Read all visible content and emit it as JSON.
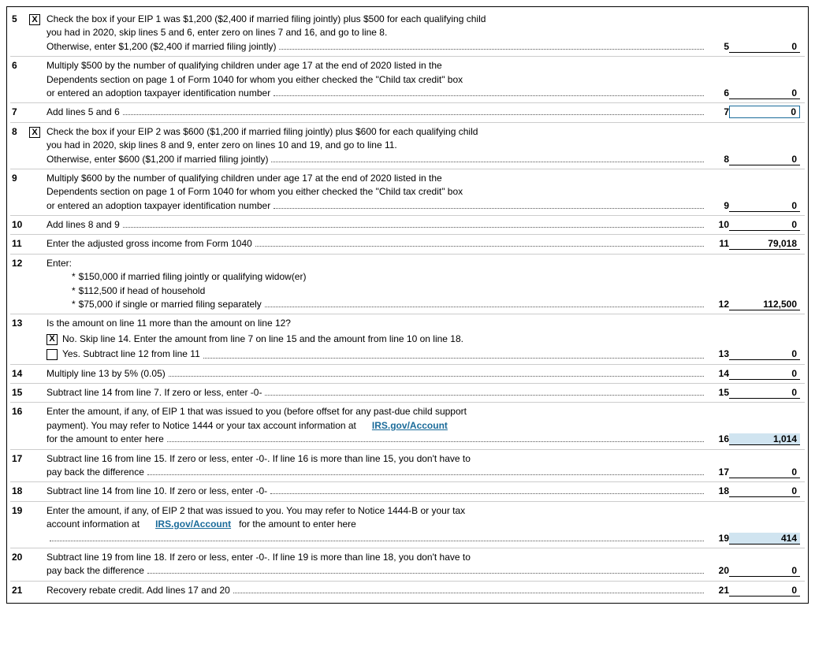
{
  "form": {
    "rows": [
      {
        "id": "row5",
        "lineNum": "5",
        "hasCheckbox": true,
        "checkboxChecked": true,
        "checkboxLabel": "X",
        "content": [
          "Check the box if your EIP 1 was $1,200 ($2,400 if married filing jointly) plus $500 for each qualifying child",
          "you had in 2020, skip lines 5 and 6, enter zero on lines 7 and 16, and go to line 8.",
          "Otherwise, enter $1,200 ($2,400 if married filing jointly)"
        ],
        "dotsLabel": "5",
        "value": "0",
        "valueStyle": "normal"
      },
      {
        "id": "row6",
        "lineNum": "6",
        "hasCheckbox": false,
        "content": [
          "Multiply $500 by the number of qualifying children under age 17 at the end of 2020 listed in the",
          "Dependents section on page 1 of Form 1040 for whom you either checked the \"Child tax credit\" box",
          "or entered an adoption taxpayer identification number"
        ],
        "dotsLabel": "6",
        "value": "0",
        "valueStyle": "normal"
      },
      {
        "id": "row7",
        "lineNum": "7",
        "hasCheckbox": false,
        "content": [
          "Add lines 5 and 6"
        ],
        "dotsLabel": "7",
        "value": "0",
        "valueStyle": "boxed"
      },
      {
        "id": "row8",
        "lineNum": "8",
        "hasCheckbox": true,
        "checkboxChecked": true,
        "checkboxLabel": "X",
        "content": [
          "Check the box if your EIP 2 was $600 ($1,200 if married filing jointly) plus $600 for each qualifying child",
          "you had in 2020, skip lines 8 and 9, enter zero on lines 10 and 19, and go to line 11.",
          "Otherwise, enter $600 ($1,200 if married filing jointly)"
        ],
        "dotsLabel": "8",
        "value": "0",
        "valueStyle": "normal"
      },
      {
        "id": "row9",
        "lineNum": "9",
        "hasCheckbox": false,
        "content": [
          "Multiply $600 by the number of qualifying children under age 17 at the end of 2020 listed in the",
          "Dependents section on page 1 of Form 1040 for whom you either checked the \"Child tax credit\" box",
          "or entered an adoption taxpayer identification number"
        ],
        "dotsLabel": "9",
        "value": "0",
        "valueStyle": "normal"
      },
      {
        "id": "row10",
        "lineNum": "10",
        "hasCheckbox": false,
        "content": [
          "Add lines 8 and 9"
        ],
        "dotsLabel": "10",
        "value": "0",
        "valueStyle": "normal"
      },
      {
        "id": "row11",
        "lineNum": "11",
        "hasCheckbox": false,
        "content": [
          "Enter the adjusted gross income from Form 1040"
        ],
        "dotsLabel": "11",
        "value": "79,018",
        "valueStyle": "normal"
      },
      {
        "id": "row12",
        "lineNum": "12",
        "hasCheckbox": false,
        "isEnter": true,
        "content": [
          "Enter:"
        ],
        "bullets": [
          "$150,000 if married filing jointly or qualifying widow(er)",
          "$112,500 if head of household",
          "$75,000 if single or married filing separately"
        ],
        "dotsLabel": "12",
        "value": "112,500",
        "valueStyle": "normal"
      },
      {
        "id": "row13",
        "lineNum": "13",
        "hasCheckbox": false,
        "isSpecial13": true,
        "contentLine1": "Is the amount on line 11 more than the amount on line 12?",
        "noOption": {
          "checked": true,
          "label": "X",
          "text": "No. Skip line 14. Enter the amount from line 7 on line 15 and the amount from line 10 on line 18."
        },
        "yesOption": {
          "checked": false,
          "label": "",
          "text": "Yes. Subtract line 12 from line 11"
        },
        "dotsLabel": "13",
        "value": "0",
        "valueStyle": "normal"
      },
      {
        "id": "row14",
        "lineNum": "14",
        "hasCheckbox": false,
        "content": [
          "Multiply line 13 by 5% (0.05)"
        ],
        "dotsLabel": "14",
        "value": "0",
        "valueStyle": "normal"
      },
      {
        "id": "row15",
        "lineNum": "15",
        "hasCheckbox": false,
        "content": [
          "Subtract line 14 from line 7. If zero or less, enter  -0-"
        ],
        "dotsLabel": "15",
        "value": "0",
        "valueStyle": "normal"
      },
      {
        "id": "row16",
        "lineNum": "16",
        "hasCheckbox": false,
        "content": [
          "Enter the amount, if any, of EIP 1 that was issued to you (before offset for any past-due child support",
          "payment). You may refer to Notice 1444 or your tax account information at",
          "for the amount to enter here"
        ],
        "linkText": "IRS.gov/Account",
        "dotsLabel": "16",
        "value": "1,014",
        "valueStyle": "highlighted"
      },
      {
        "id": "row17",
        "lineNum": "17",
        "hasCheckbox": false,
        "content": [
          "Subtract line 16 from line 15. If zero or less, enter -0-. If line 16 is more than line 15, you don't have to",
          "pay back the difference"
        ],
        "dotsLabel": "17",
        "value": "0",
        "valueStyle": "normal"
      },
      {
        "id": "row18",
        "lineNum": "18",
        "hasCheckbox": false,
        "content": [
          "Subtract line 14 from line 10. If zero or less, enter -0-"
        ],
        "dotsLabel": "18",
        "value": "0",
        "valueStyle": "normal"
      },
      {
        "id": "row19",
        "lineNum": "19",
        "hasCheckbox": false,
        "content": [
          "Enter the amount, if any, of EIP 2 that was issued to you. You may refer to Notice 1444-B or your tax",
          "account information at",
          "for the amount to enter here"
        ],
        "linkText": "IRS.gov/Account",
        "dotsLabel": "19",
        "value": "414",
        "valueStyle": "highlighted"
      },
      {
        "id": "row20",
        "lineNum": "20",
        "hasCheckbox": false,
        "content": [
          "Subtract line 19 from line 18. If zero or less, enter -0-. If line 19 is more than line 18, you don't have to",
          "pay back the difference"
        ],
        "dotsLabel": "20",
        "value": "0",
        "valueStyle": "normal"
      },
      {
        "id": "row21",
        "lineNum": "21",
        "hasCheckbox": false,
        "content": [
          "Recovery rebate credit. Add lines 17 and 20"
        ],
        "dotsLabel": "21",
        "value": "0",
        "valueStyle": "normal"
      }
    ]
  }
}
